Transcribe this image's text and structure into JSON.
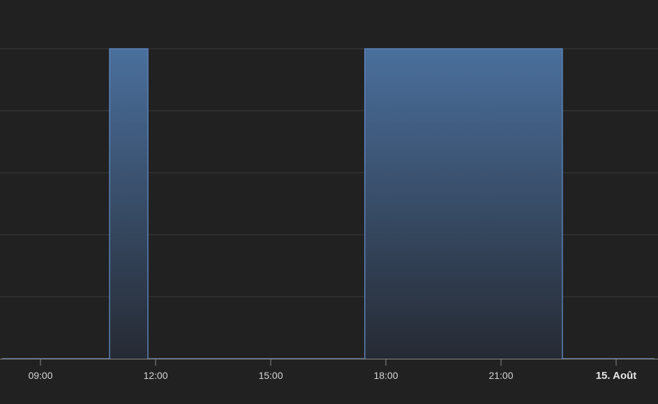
{
  "chart_data": {
    "type": "area",
    "step": true,
    "x_unit": "hours (day of 14 Aug, continuing into 15 Aug)",
    "x_range": [
      8.0,
      25.0
    ],
    "ylim": [
      0,
      1
    ],
    "grid": true,
    "legend": "none",
    "title": "",
    "xlabel": "",
    "ylabel": "",
    "x_ticks": [
      {
        "value": 9,
        "label": "09:00",
        "bold": false
      },
      {
        "value": 12,
        "label": "12:00",
        "bold": false
      },
      {
        "value": 15,
        "label": "15:00",
        "bold": false
      },
      {
        "value": 18,
        "label": "18:00",
        "bold": false
      },
      {
        "value": 21,
        "label": "21:00",
        "bold": false
      },
      {
        "value": 24,
        "label": "15. Août",
        "bold": true
      }
    ],
    "y_gridlines": [
      0.2,
      0.4,
      0.6,
      0.8,
      1.0
    ],
    "series": [
      {
        "color": "#4a6f9c",
        "points": [
          {
            "x": 8.0,
            "y": 0
          },
          {
            "x": 10.8,
            "y": 0
          },
          {
            "x": 10.8,
            "y": 1
          },
          {
            "x": 11.8,
            "y": 1
          },
          {
            "x": 11.8,
            "y": 0
          },
          {
            "x": 17.45,
            "y": 0
          },
          {
            "x": 17.45,
            "y": 1
          },
          {
            "x": 22.6,
            "y": 1
          },
          {
            "x": 22.6,
            "y": 0
          },
          {
            "x": 25.0,
            "y": 0
          }
        ]
      }
    ],
    "colors": {
      "background": "#212121",
      "grid": "#3a3a3a",
      "line": "#5b82b8",
      "fill_top": "#4a6f9c",
      "fill_bottom": "#262a33",
      "axis": "#8a8a8a"
    }
  }
}
